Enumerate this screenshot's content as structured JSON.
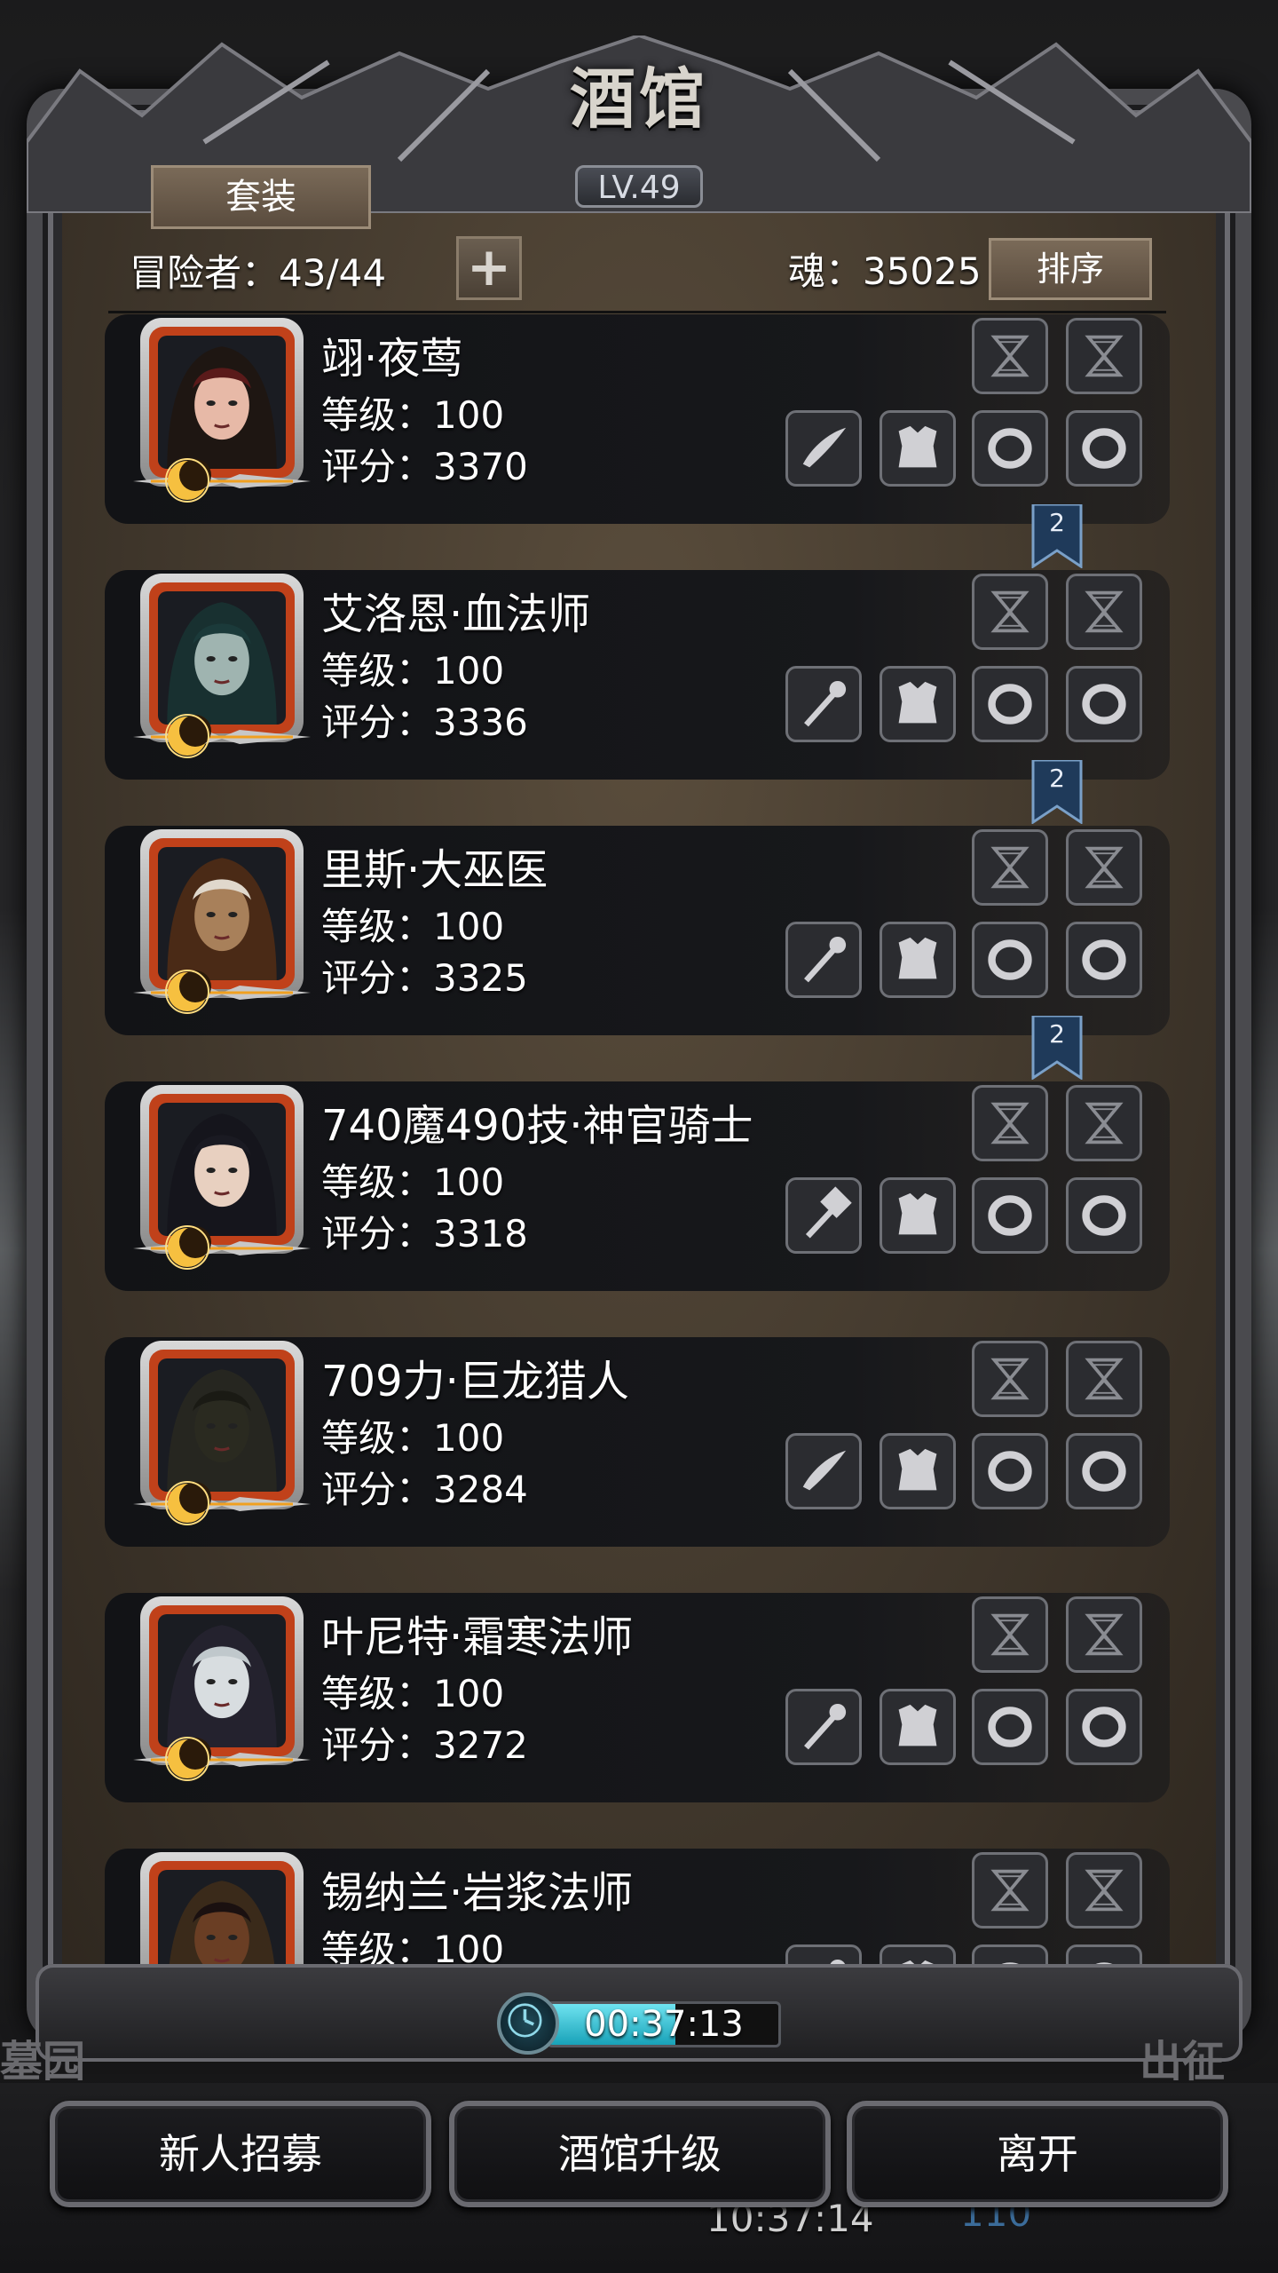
{
  "header": {
    "title": "酒馆",
    "level": "LV.49",
    "set_button": "套装",
    "adventurer_label": "冒险者：43/44",
    "add_button": "+",
    "soul_label": "魂：35025",
    "sort_button": "排序"
  },
  "heroes": [
    {
      "name": "翊·夜莺",
      "level": "等级：100",
      "score": "评分：3370",
      "weapon": "blade",
      "flag": "2",
      "skin": "#e7b9a7",
      "hair": "#5a1a1a",
      "hood": "#1e1612"
    },
    {
      "name": "艾洛恩·血法师",
      "level": "等级：100",
      "score": "评分：3336",
      "weapon": "staff",
      "flag": "2",
      "skin": "#9fb4b0",
      "hair": "#1b3a3a",
      "hood": "#183030"
    },
    {
      "name": "里斯·大巫医",
      "level": "等级：100",
      "score": "评分：3325",
      "weapon": "staff",
      "flag": "2",
      "skin": "#a8805a",
      "hair": "#e0d8cc",
      "hood": "#4a2a16"
    },
    {
      "name": "740魔490技·神官骑士",
      "level": "等级：100",
      "score": "评分：3318",
      "weapon": "hammer",
      "flag": "",
      "skin": "#e8d0c0",
      "hair": "#1a1a22",
      "hood": "#15151c"
    },
    {
      "name": "709力·巨龙猎人",
      "level": "等级：100",
      "score": "评分：3284",
      "weapon": "blade",
      "flag": "",
      "skin": "#2a2a20",
      "hair": "#1a1a14",
      "hood": "#262620"
    },
    {
      "name": "叶尼特·霜寒法师",
      "level": "等级：100",
      "score": "评分：3272",
      "weapon": "staff",
      "flag": "",
      "skin": "#d8dde0",
      "hair": "#c0c8cc",
      "hood": "#24222e"
    },
    {
      "name": "锡纳兰·岩浆法师",
      "level": "等级：100",
      "score": "",
      "weapon": "staff",
      "flag": "",
      "skin": "#6a3e24",
      "hair": "#1a1010",
      "hood": "#3a2a1a"
    }
  ],
  "timer": {
    "time": "00:37:13",
    "progress": 0.55
  },
  "under_labels": {
    "left": "墓园",
    "right": "出征",
    "clock": "10:37:14",
    "count": "110"
  },
  "footer": {
    "recruit": "新人招募",
    "upgrade": "酒馆升级",
    "leave": "离开"
  },
  "colors": {
    "portrait_frame": "#c0411a",
    "flag": "#1f3a5a",
    "timer_fill": "#2cc6d8"
  }
}
